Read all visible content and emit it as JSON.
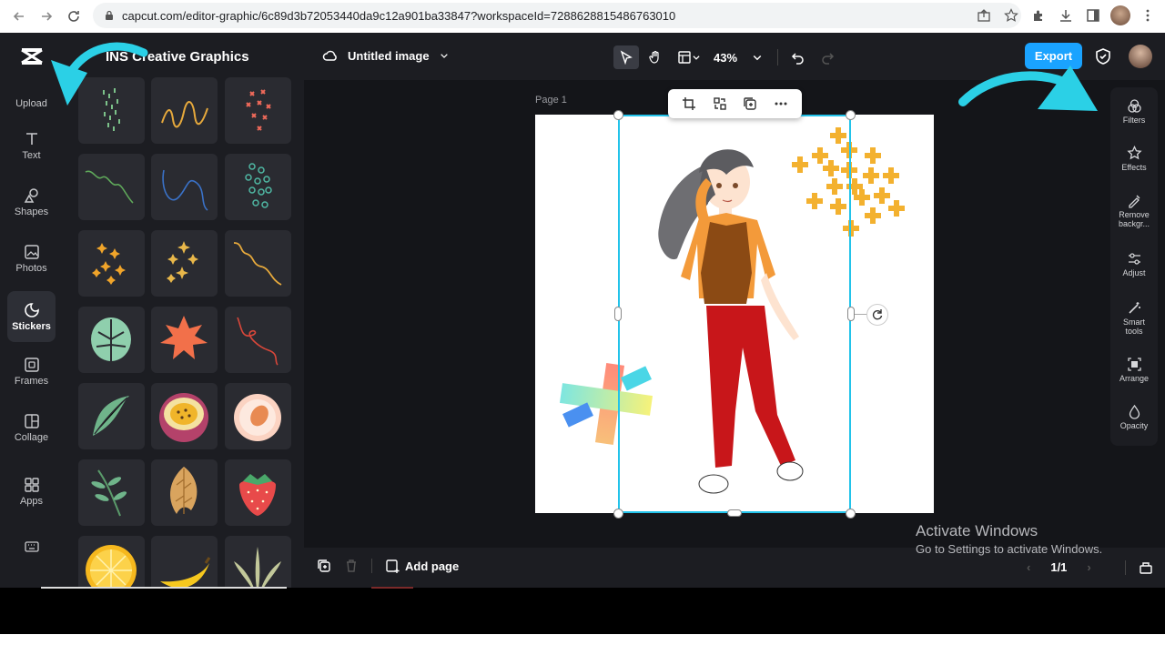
{
  "browser": {
    "url": "capcut.com/editor-graphic/6c89d3b72053440da9c12a901ba33847?workspaceId=7288628815486763010"
  },
  "rail": {
    "items": [
      {
        "label": "Upload",
        "icon": "upload-icon"
      },
      {
        "label": "Text",
        "icon": "text-icon"
      },
      {
        "label": "Shapes",
        "icon": "shapes-icon"
      },
      {
        "label": "Photos",
        "icon": "photos-icon"
      },
      {
        "label": "Stickers",
        "icon": "stickers-icon",
        "active": true
      },
      {
        "label": "Frames",
        "icon": "frames-icon"
      },
      {
        "label": "Collage",
        "icon": "collage-icon"
      },
      {
        "label": "Apps",
        "icon": "apps-icon"
      }
    ]
  },
  "panel": {
    "title": "INS Creative Graphics"
  },
  "topbar": {
    "doc_title": "Untitled image",
    "zoom": "43%",
    "export_label": "Export"
  },
  "canvas": {
    "page_label": "Page 1"
  },
  "right_rail": {
    "items": [
      {
        "label": "Filters",
        "icon": "filters-icon"
      },
      {
        "label": "Effects",
        "icon": "effects-icon"
      },
      {
        "label": "Remove backgr...",
        "icon": "remove-background-icon"
      },
      {
        "label": "Adjust",
        "icon": "adjust-icon"
      },
      {
        "label": "Smart tools",
        "icon": "smart-tools-icon"
      },
      {
        "label": "Arrange",
        "icon": "arrange-icon"
      },
      {
        "label": "Opacity",
        "icon": "opacity-icon"
      }
    ]
  },
  "bottombar": {
    "add_page": "Add page",
    "pager": "1/1"
  },
  "watermark": {
    "line1": "Activate Windows",
    "line2": "Go to Settings to activate Windows."
  },
  "colors": {
    "accent": "#1aa3ff",
    "selection": "#22c3ea",
    "arrow": "#2bd0e6"
  }
}
